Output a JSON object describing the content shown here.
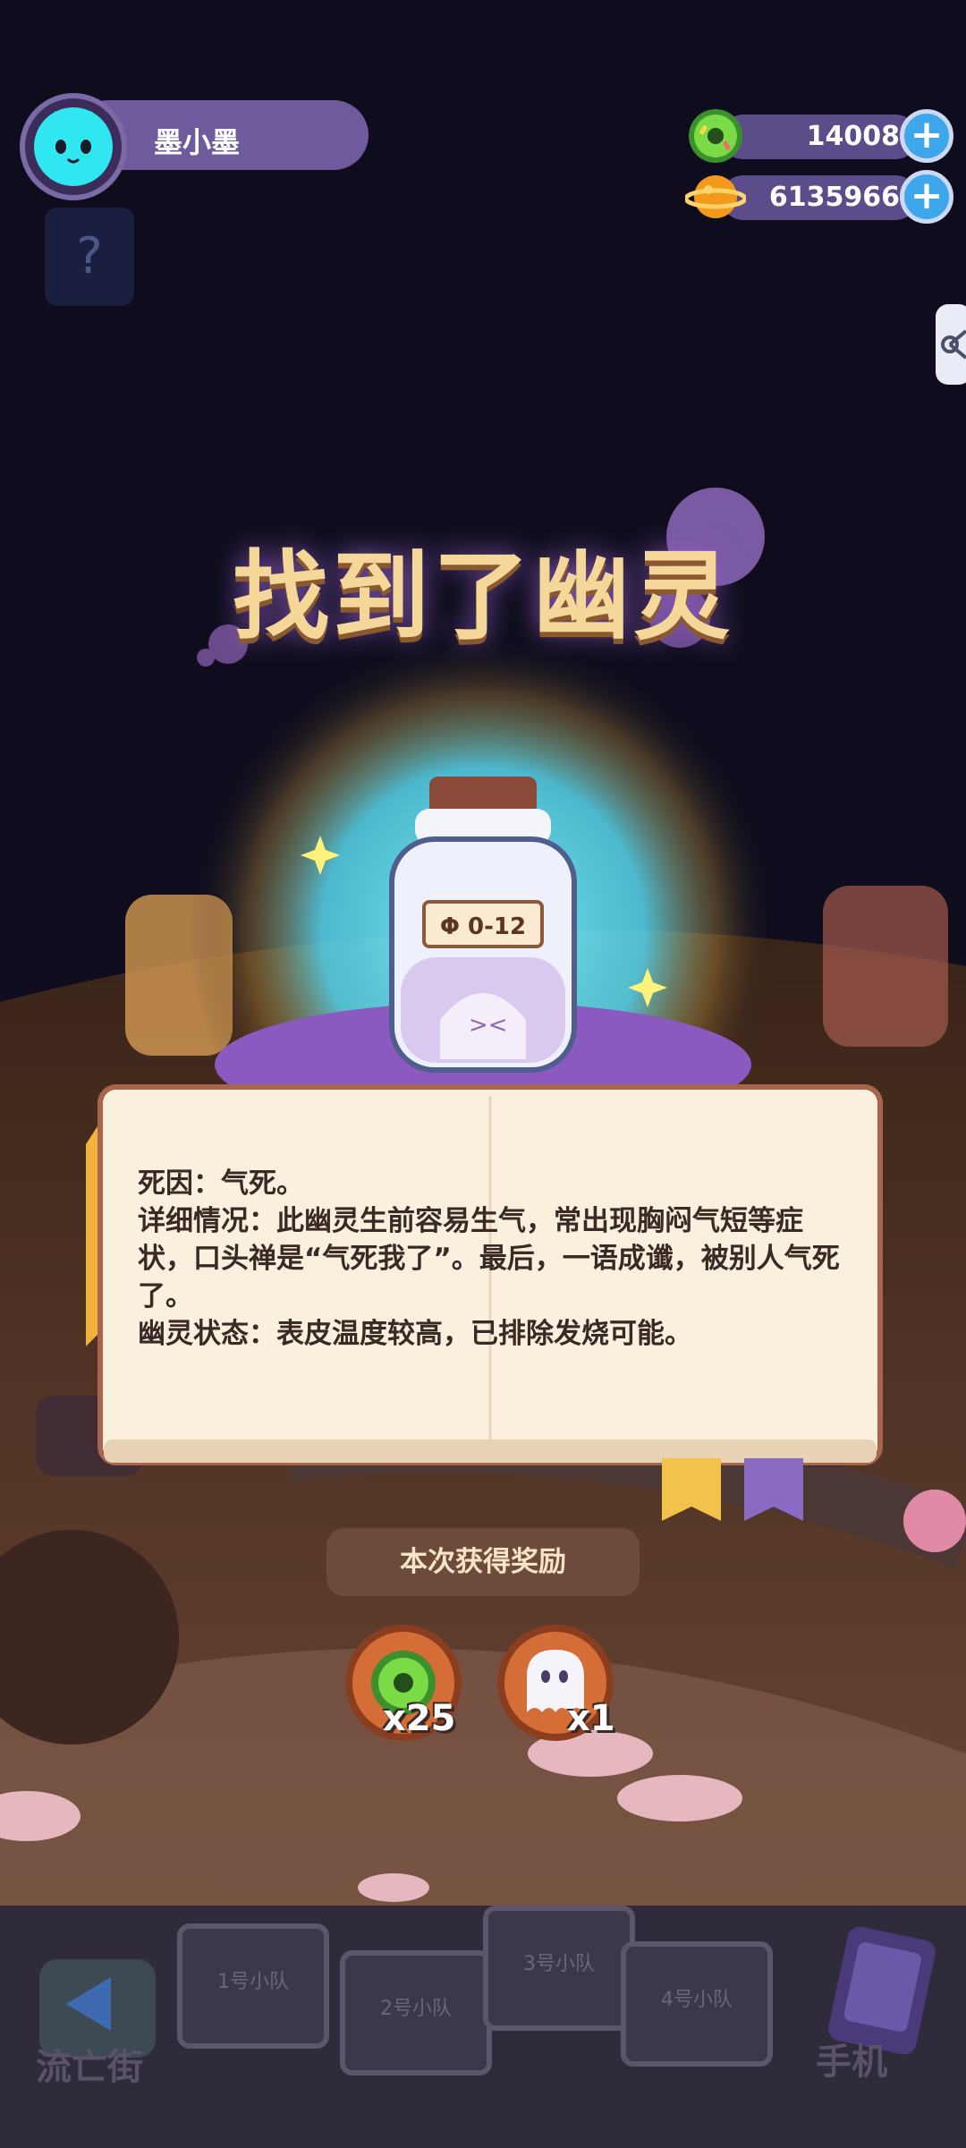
{
  "player": {
    "name": "墨小墨"
  },
  "mystery_badge": "?",
  "currencies": {
    "donuts": {
      "value": "14008",
      "icon": "green-donut-icon"
    },
    "coins": {
      "value": "6135966",
      "icon": "orange-planet-coin-icon"
    },
    "add_symbol": "+"
  },
  "title": "找到了幽灵",
  "bottle": {
    "label": "Φ 0-12"
  },
  "book": {
    "lines": [
      "死因：气死。",
      "详细情况：此幽灵生前容易生气，常出现胸闷气短等症状，口头禅是“气死我了”。最后，一语成谶，被别人气死了。",
      "幽灵状态：表皮温度较高，已排除发烧可能。"
    ]
  },
  "rewards": {
    "title": "本次获得奖励",
    "items": [
      {
        "icon": "green-donut-icon",
        "count": "x25"
      },
      {
        "icon": "ghost-icon",
        "count": "x1"
      }
    ]
  },
  "dock": {
    "left_label": "流亡街",
    "right_label": "手机",
    "slots": [
      "1号小队",
      "2号小队",
      "3号小队",
      "4号小队"
    ]
  },
  "colors": {
    "background": "#0f0d1d",
    "accent_purple": "#6e5a9c",
    "book_paper": "#fbf0de"
  }
}
